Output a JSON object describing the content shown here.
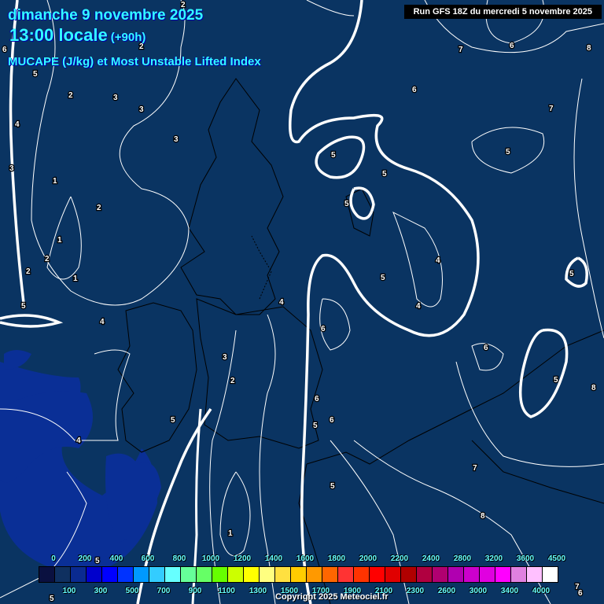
{
  "header": {
    "date": "dimanche 9 novembre 2025",
    "time": "13:00 locale",
    "lead": "(+90h)",
    "parameter": "MUCAPE (J/kg) et Most Unstable Lifted Index",
    "run": "Run GFS 18Z du mercredi 5 novembre 2025"
  },
  "legend": {
    "top_labels": [
      "0",
      "200",
      "400",
      "600",
      "800",
      "1000",
      "1200",
      "1400",
      "1600",
      "1800",
      "2000",
      "2200",
      "2400",
      "2800",
      "3200",
      "3600",
      "4500"
    ],
    "bottom_labels": [
      "100",
      "300",
      "500",
      "700",
      "900",
      "1100",
      "1300",
      "1500",
      "1700",
      "1900",
      "2100",
      "2300",
      "2600",
      "3000",
      "3400",
      "4000"
    ],
    "colors": [
      "#0a1040",
      "#0f3060",
      "#0a2a90",
      "#0000cc",
      "#0000ff",
      "#0033ff",
      "#0099ff",
      "#33ccff",
      "#66ffff",
      "#66ff99",
      "#66ff66",
      "#66ff00",
      "#ccff00",
      "#ffff00",
      "#ffff80",
      "#ffe040",
      "#ffcc00",
      "#ff9900",
      "#ff6600",
      "#ff3333",
      "#ff3300",
      "#ff0000",
      "#e00000",
      "#b00000",
      "#b00040",
      "#b00070",
      "#b000b0",
      "#cc00cc",
      "#e000e0",
      "#ff00ff",
      "#e080e0",
      "#ffc0ff",
      "#ffffff"
    ]
  },
  "contour_labels": [
    "2",
    "6",
    "5",
    "2",
    "2",
    "3",
    "3",
    "4",
    "3",
    "3",
    "1",
    "2",
    "1",
    "2",
    "2",
    "1",
    "5",
    "4",
    "7",
    "6",
    "8",
    "6",
    "7",
    "5",
    "5",
    "5",
    "5",
    "4",
    "5",
    "5",
    "4",
    "4",
    "6",
    "6",
    "3",
    "2",
    "5",
    "8",
    "6",
    "6",
    "5",
    "5",
    "4",
    "7",
    "5",
    "8",
    "1",
    "5",
    "5",
    "7",
    "6"
  ],
  "copyright": "Copyright 2025 Meteociel.fr",
  "colors": {
    "background": "#0a3462",
    "shade": "#0a2f96",
    "title": "#33ffff"
  }
}
